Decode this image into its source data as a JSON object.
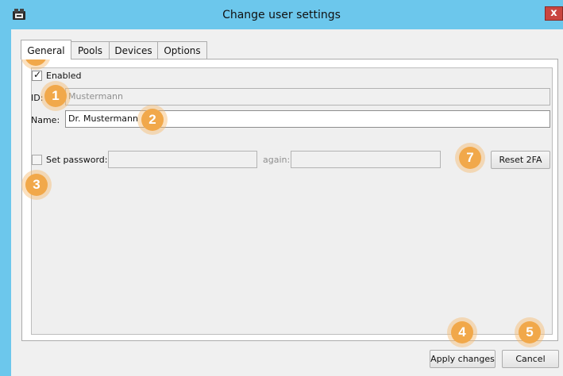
{
  "window": {
    "title": "Change user settings",
    "close_label": "x"
  },
  "tabs": [
    {
      "label": "General",
      "active": true
    },
    {
      "label": "Pools",
      "active": false
    },
    {
      "label": "Devices",
      "active": false
    },
    {
      "label": "Options",
      "active": false
    }
  ],
  "general": {
    "enabled_label": "Enabled",
    "enabled_checked": true,
    "id_label": "ID:",
    "id_value": "Mustermann",
    "name_label": "Name:",
    "name_value": "Dr. Mustermann",
    "set_password_label": "Set password:",
    "set_password_checked": false,
    "again_label": "again:",
    "password_value": "",
    "password_again_value": "",
    "reset_2fa_label": "Reset 2FA"
  },
  "footer": {
    "apply_label": "Apply changes",
    "cancel_label": "Cancel"
  },
  "callouts": [
    "1",
    "2",
    "3",
    "4",
    "5",
    "6",
    "7"
  ],
  "colors": {
    "titlebar": "#6cc7ec",
    "callout": "#f1a84a",
    "close": "#c9453f"
  }
}
